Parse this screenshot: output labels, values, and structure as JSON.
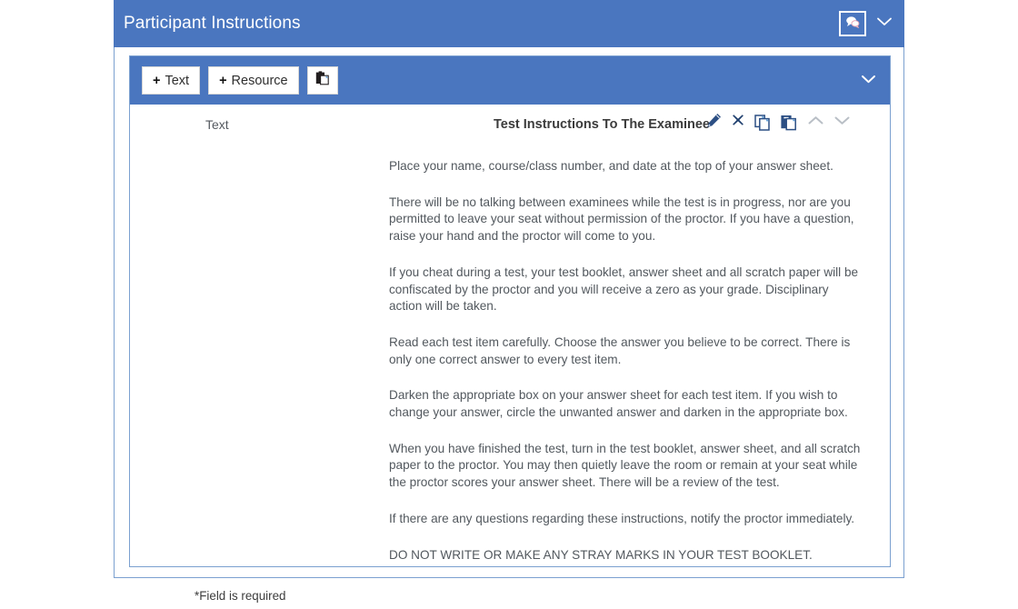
{
  "header": {
    "title": "Participant Instructions",
    "chat_icon": "chat-bubbles-icon",
    "collapse_icon": "chevron-down-icon"
  },
  "toolbar": {
    "add_text_label": "Text",
    "add_resource_label": "Resource",
    "plus_glyph": "+",
    "paste_icon": "paste-icon",
    "collapse_icon": "chevron-down-icon"
  },
  "item": {
    "type_label": "Text",
    "title": "Test Instructions To The Examinee",
    "actions": {
      "edit": "pencil-icon",
      "delete": "close-x-icon",
      "copy": "copy-icon",
      "paste": "paste-icon",
      "move_up": "chevron-up-icon",
      "move_down": "chevron-down-icon"
    },
    "paragraphs": [
      "Place your name, course/class number, and date at the top of your answer sheet.",
      "There will be no talking between examinees while the test is in progress, nor are you permitted to leave your seat without permission of the proctor. If you have a question, raise your hand and the proctor will come to you.",
      "If you cheat during a test, your test booklet, answer sheet and all scratch paper will be confiscated by the proctor and you will receive a zero as your grade. Disciplinary action will be taken.",
      "Read each test item carefully. Choose the answer you believe to be correct. There is only one correct answer to every test item.",
      "Darken the appropriate box on your answer sheet for each test item. If you wish to change your answer, circle the unwanted answer and darken in the appropriate box.",
      "When you have finished the test, turn in the test booklet, answer sheet, and all scratch paper to the proctor. You may then quietly leave the room or remain at your seat while the proctor scores your answer sheet. There will be a review of the test.",
      "If there are any questions regarding these instructions, notify the proctor immediately.",
      "DO NOT WRITE OR MAKE ANY STRAY MARKS IN YOUR TEST BOOKLET."
    ]
  },
  "footer": {
    "required_note_marker": "*",
    "required_note": "Field is required"
  },
  "colors": {
    "header_blue": "#4a76bf",
    "panel_border": "#7ba0d0",
    "icon_dark_blue": "#2c4f84",
    "icon_disabled": "#b9bfc6",
    "body_text": "#52585e"
  }
}
